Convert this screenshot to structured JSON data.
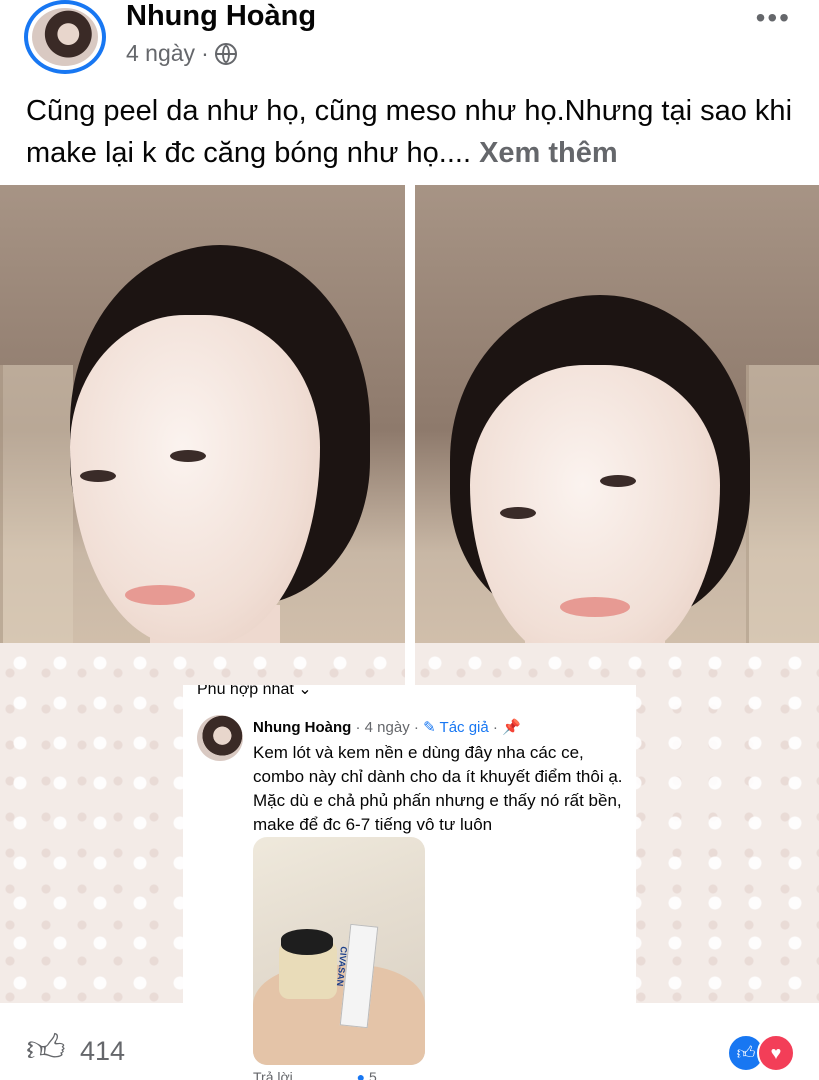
{
  "post": {
    "author": "Nhung Hoàng",
    "time": "4 ngày",
    "separator": "·",
    "text": "Cũng peel da như họ, cũng meso như họ.Nhưng tại sao khi make lại k đc căng bóng như họ....",
    "see_more": "Xem thêm",
    "more_icon": "•••"
  },
  "comment": {
    "sort_label": "Phù hợp nhất ⌄",
    "author": "Nhung Hoàng",
    "time": "4 ngày",
    "author_tag": "Tác giả",
    "text": "Kem lót và kem nền e dùng đây nha các ce, combo này chỉ dành cho da ít khuyết điểm thôi ạ. Mặc dù e chả phủ phấn nhưng e thấy nó rất bền, make để đc 6-7 tiếng vô tư luôn",
    "product_label": "CIVASAN",
    "reply_label": "Trả lời",
    "like_count": "5"
  },
  "footer": {
    "like_count": "414"
  },
  "colors": {
    "accent": "#1877f2",
    "love": "#f33e58",
    "secondary_text": "#65676b"
  }
}
